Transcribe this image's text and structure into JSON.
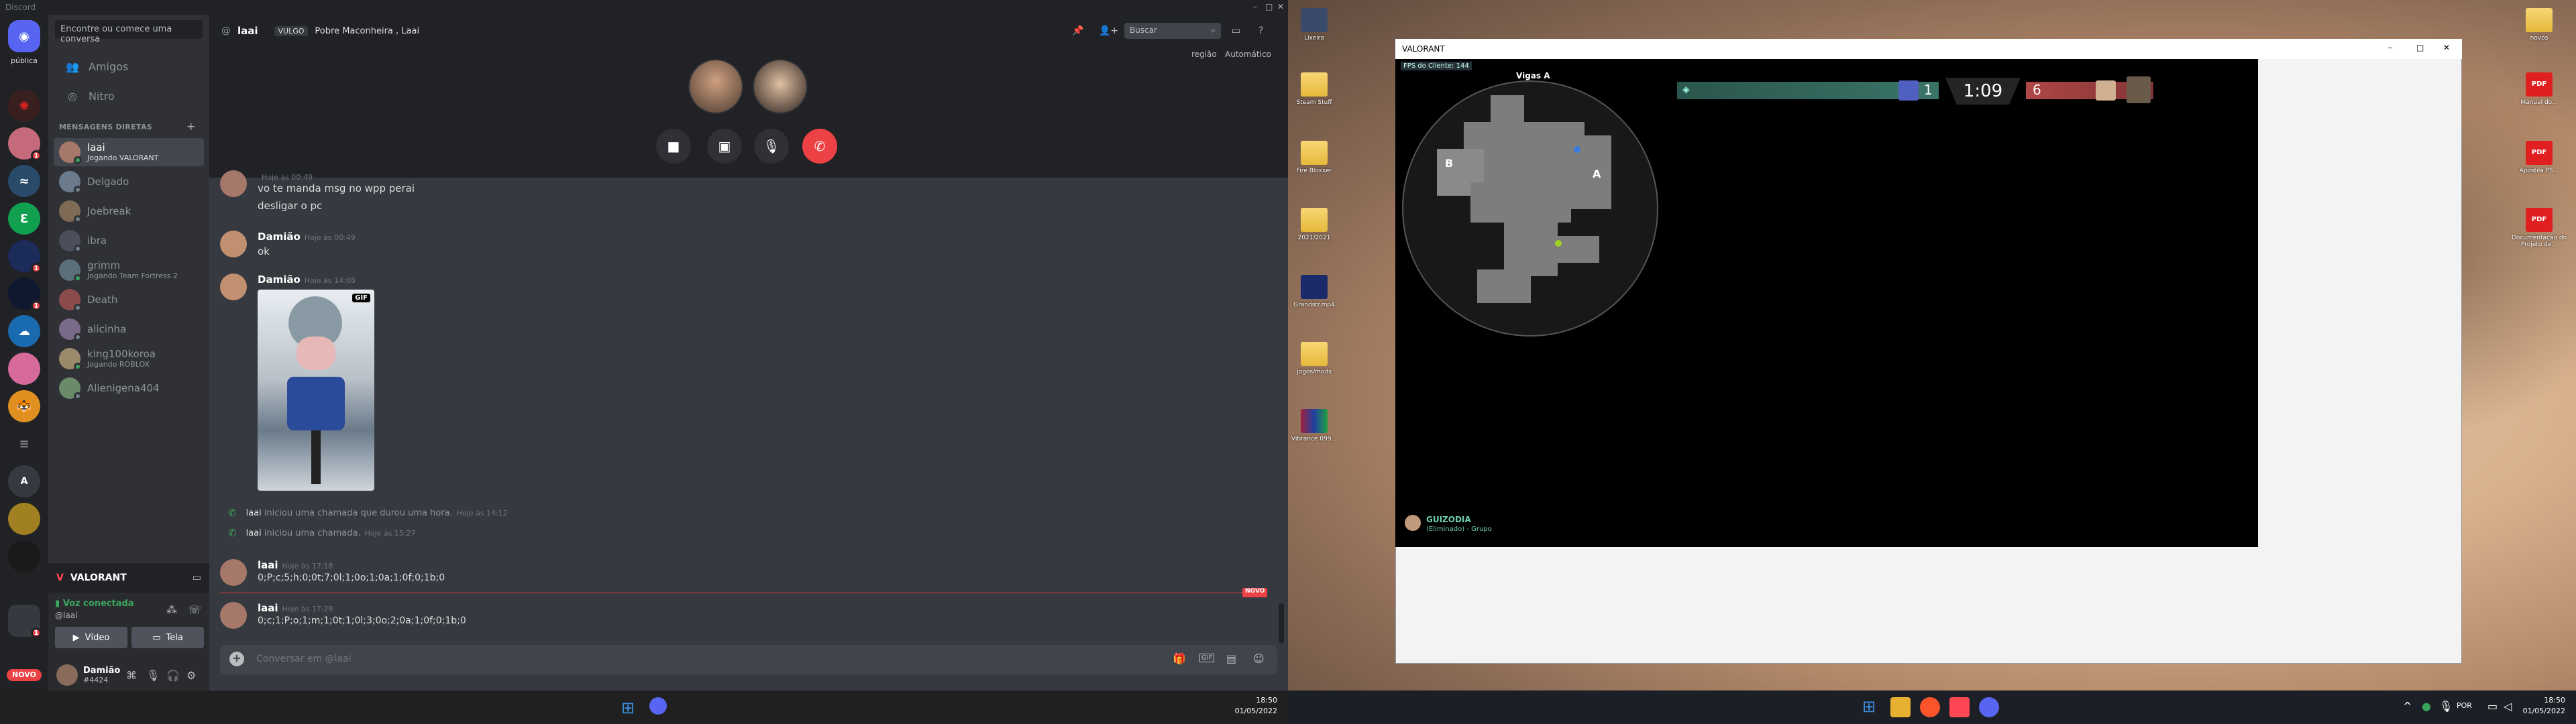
{
  "discord": {
    "app_title": "Discord",
    "server_label": "pública",
    "new_badge": "NOVO",
    "guild_badges": [
      "1",
      "1",
      "1",
      "1"
    ],
    "search_placeholder": "Encontre ou comece uma conversa",
    "nav": [
      {
        "label": "Amigos",
        "icon": "friends-icon"
      },
      {
        "label": "Nitro",
        "icon": "nitro-icon"
      }
    ],
    "dm_header": "MENSAGENS DIRETAS",
    "dms": [
      {
        "name": "laai",
        "status": "Jogando VALORANT",
        "selected": true,
        "color": "#a5786a"
      },
      {
        "name": "Delgado",
        "status": "",
        "color": "#6b7b8c"
      },
      {
        "name": "Joebreak",
        "status": "",
        "color": "#7f6a56"
      },
      {
        "name": "ibra",
        "status": "",
        "color": "#4a4f5a"
      },
      {
        "name": "grimm",
        "status": "Jogando Team Fortress 2",
        "color": "#5a6f7a"
      },
      {
        "name": "Death",
        "status": "",
        "color": "#8c4b4b"
      },
      {
        "name": "alicinha",
        "status": "",
        "color": "#7a6a8a"
      },
      {
        "name": "king100koroa",
        "status": "Jogando ROBLOX",
        "color": "#9b8a6a"
      },
      {
        "name": "Alienigena404",
        "status": "",
        "color": "#6a8a6a"
      }
    ],
    "activity": "VALORANT",
    "voice_status": "Voz conectada",
    "voice_sub": "@laai",
    "video_label": "Vídeo",
    "screen_label": "Tela",
    "user_name": "Damião",
    "user_tag": "#4424",
    "chat": {
      "header_name": "laai",
      "header_badge": "VULGO",
      "header_members": "Pobre Maconheira , Laai",
      "search": "Buscar",
      "region_label": "região",
      "region_value": "Automático",
      "messages": [
        {
          "who": "",
          "time": "Hoje às 00:49",
          "lines": [
            "vo te manda msg no wpp perai",
            "desligar o pc"
          ]
        },
        {
          "who": "Damião",
          "time": "Hoje às 00:49",
          "lines": [
            "ok"
          ]
        },
        {
          "who": "Damião",
          "time": "Hoje às 14:08",
          "lines": []
        },
        {
          "who": "laai",
          "time": "Hoje às 17:18",
          "lines": [
            "0;P;c;5;h;0;0t;7;0l;1;0o;1;0a;1;0f;0;1b;0"
          ]
        },
        {
          "who": "laai",
          "time": "Hoje às 17:28",
          "lines": [
            "0;c;1;P;o;1;m;1;0t;1;0l;3;0o;2;0a;1;0f;0;1b;0"
          ]
        }
      ],
      "gif_label": "GIF",
      "system": [
        {
          "who": "laai",
          "text": "iniciou uma chamada que durou uma hora.",
          "time": "Hoje às 14:12"
        },
        {
          "who": "laai",
          "text": "iniciou uma chamada.",
          "time": "Hoje às 15:27"
        }
      ],
      "new_label": "NOVO",
      "composer_placeholder": "Conversar em @laai"
    },
    "clock_time": "18:50",
    "clock_date": "01/05/2022"
  },
  "desktop": {
    "icons": [
      "Lixeira",
      "Steam Stuff",
      "Fire Bloxxer",
      "2021/2021",
      "Grandstr.mp4",
      "jogos/mods",
      "Vibrance 099..."
    ],
    "right_icons": [
      "novos",
      "Manual do...",
      "Apostila PS...",
      "Documentação do Projeto de..."
    ],
    "pdf_label": "PDF",
    "valorant": {
      "window_title": "VALORANT",
      "fps": "FPS do Cliente: 144",
      "site": "Vigas A",
      "score_left": "1",
      "timer": "1:09",
      "score_right": "6",
      "map_site_a": "A",
      "map_site_b": "B",
      "player_name": "GUIZODIA",
      "player_sub": "(Eliminado) - Grupo"
    },
    "tray_lang": "POR",
    "clock_time": "18:50",
    "clock_date": "01/05/2022"
  },
  "colors": {
    "discord_bg": "#36393f",
    "blurple": "#5865f2",
    "green": "#3ba55d",
    "red": "#ed4245",
    "val_teal": "#3d7a6d",
    "val_red": "#b84a4a"
  }
}
